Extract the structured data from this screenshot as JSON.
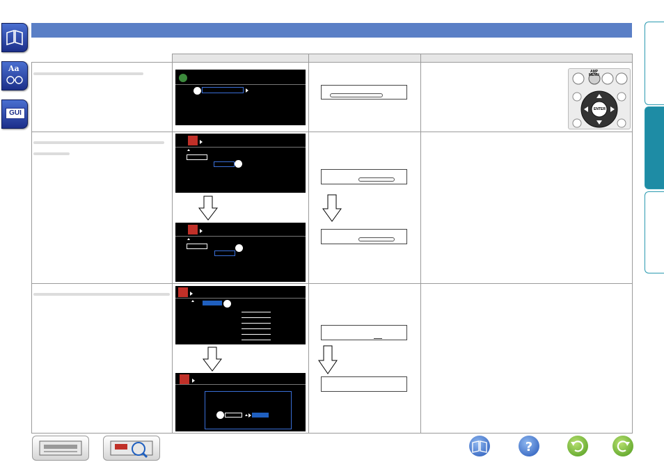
{
  "sidebar": {
    "icons": [
      "manual-book-icon",
      "glossary-aa-icon",
      "gui-icon"
    ],
    "gui_label": "GUI",
    "aa_label": "Aa"
  },
  "remote": {
    "amp_label": "AMP",
    "menu_label": "MENU",
    "enter_label": "ENTER"
  },
  "colors": {
    "header_bar": "#5a7fc6",
    "tab_active": "#1e8ca5",
    "screen_bg": "#000000",
    "highlight": "#1f5fbf"
  },
  "bottom": {
    "device_buttons": [
      "receiver-front-icon",
      "receiver-rear-icon"
    ],
    "nav_buttons": [
      "manual-book-icon",
      "help-icon",
      "back-icon",
      "forward-icon"
    ]
  }
}
